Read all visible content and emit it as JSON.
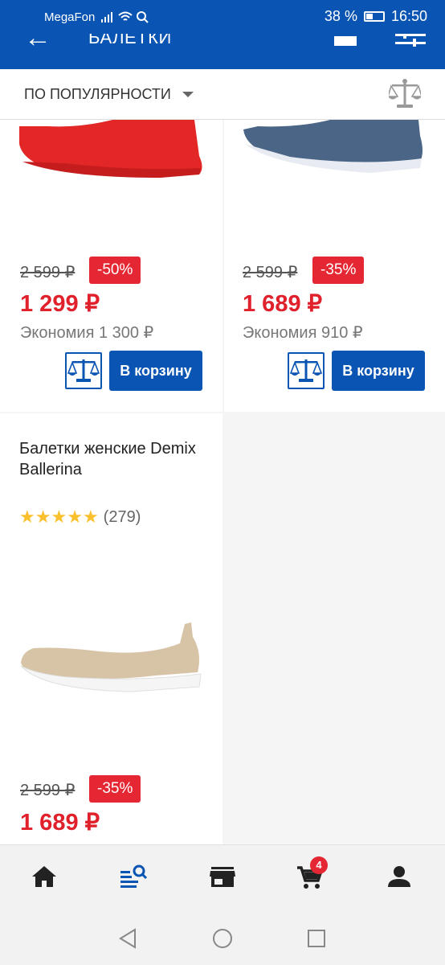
{
  "status_bar": {
    "carrier": "MegaFon",
    "battery": "38 %",
    "time": "16:50"
  },
  "header": {
    "title": "БАЛЕТКИ",
    "back_icon": "arrow-left-icon",
    "filter_icon": "sliders-icon"
  },
  "sort": {
    "label": "ПО ПОПУЛЯРНОСТИ",
    "compare_icon": "scales-icon"
  },
  "products": [
    {
      "old_price": "2 599 ₽",
      "discount": "-50%",
      "price": "1 299 ₽",
      "saving": "Экономия 1 300 ₽",
      "cart_label": "В корзину",
      "color": "#e32626"
    },
    {
      "old_price": "2 599 ₽",
      "discount": "-35%",
      "price": "1 689 ₽",
      "saving": "Экономия 910 ₽",
      "cart_label": "В корзину",
      "color": "#4a6585"
    },
    {
      "title": "Балетки женские Demix Ballerina",
      "rating": 5,
      "reviews": "(279)",
      "old_price": "2 599 ₽",
      "discount": "-35%",
      "price": "1 689 ₽",
      "color": "#d7c4a7"
    }
  ],
  "bottom_nav": [
    {
      "name": "home-icon"
    },
    {
      "name": "catalog-search-icon"
    },
    {
      "name": "store-icon"
    },
    {
      "name": "cart-icon",
      "badge": "4"
    },
    {
      "name": "profile-icon"
    }
  ],
  "colors": {
    "brand_blue": "#0a55b3",
    "price_red": "#e0202b",
    "star": "#fbc02d"
  }
}
